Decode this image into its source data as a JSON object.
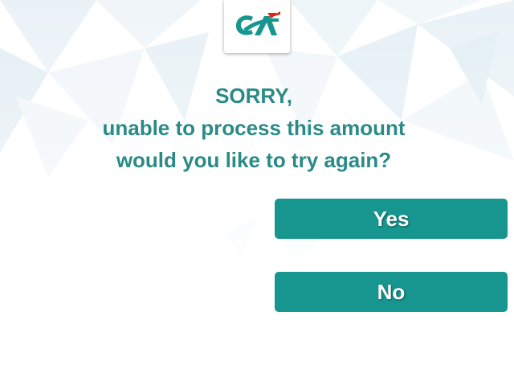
{
  "brand": {
    "logo_text": "CA",
    "colors": {
      "primary": "#17968f",
      "text": "#2a8b86",
      "accent": "#e2231a"
    }
  },
  "message": {
    "line1": "SORRY,",
    "line2": "unable to process this amount",
    "line3": "would you like to try again?"
  },
  "buttons": {
    "yes_label": "Yes",
    "no_label": "No"
  }
}
